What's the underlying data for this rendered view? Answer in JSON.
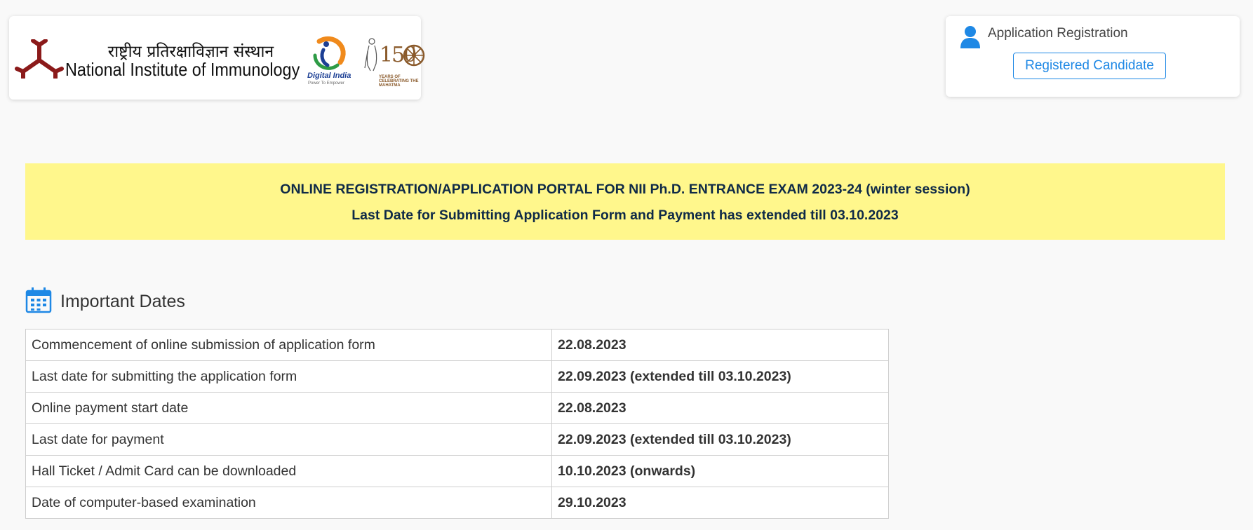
{
  "logo": {
    "hindi_name": "राष्ट्रीय प्रतिरक्षाविज्ञान संस्थान",
    "english_name": "National Institute of Immunology",
    "digital_india": "Digital India",
    "digital_india_tagline": "Power To Empower",
    "gandhi_150": "150",
    "gandhi_caption": "YEARS OF CELEBRATING THE MAHATMA"
  },
  "registration": {
    "title": "Application Registration",
    "button_label": "Registered Candidate",
    "accent_color": "#1e88e5"
  },
  "notice": {
    "line1": "ONLINE REGISTRATION/APPLICATION PORTAL FOR NII Ph.D. ENTRANCE EXAM 2023-24 (winter session)",
    "line2": "Last Date for Submitting Application Form and Payment has extended till 03.10.2023",
    "background_color": "#fff78c"
  },
  "important_dates": {
    "icon": "calendar-icon",
    "title": "Important Dates",
    "rows": [
      {
        "label": "Commencement of online submission of application form",
        "value": "22.08.2023"
      },
      {
        "label": "Last date for submitting the application form",
        "value": "22.09.2023 (extended till 03.10.2023)"
      },
      {
        "label": "Online payment start date",
        "value": "22.08.2023"
      },
      {
        "label": "Last date for payment",
        "value": "22.09.2023 (extended till 03.10.2023)"
      },
      {
        "label": "Hall Ticket / Admit Card can be downloaded",
        "value": "10.10.2023 (onwards)"
      },
      {
        "label": "Date of computer-based examination",
        "value": "29.10.2023"
      }
    ]
  }
}
